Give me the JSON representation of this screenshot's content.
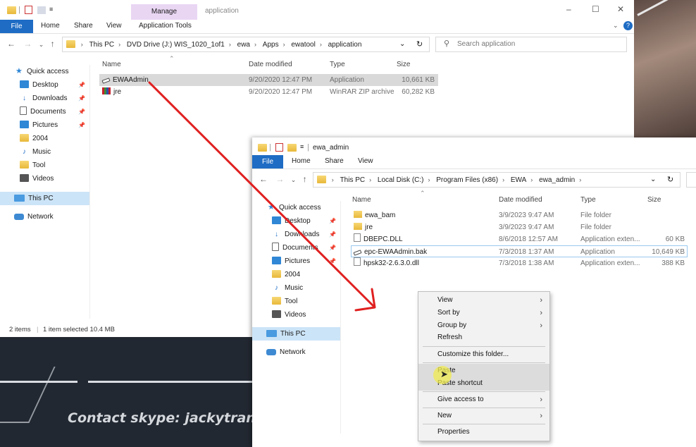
{
  "back_window": {
    "manage_tab": "Manage",
    "context_title": "application",
    "ribbon": [
      "File",
      "Home",
      "Share",
      "View",
      "Application Tools"
    ],
    "breadcrumb": [
      "This PC",
      "DVD Drive (J:) WIS_1020_1of1",
      "ewa",
      "Apps",
      "ewatool",
      "application"
    ],
    "search_placeholder": "Search application",
    "nav": [
      "Quick access",
      "Desktop",
      "Downloads",
      "Documents",
      "Pictures",
      "2004",
      "Music",
      "Tool",
      "Videos",
      "This PC",
      "Network"
    ],
    "columns": [
      "Name",
      "Date modified",
      "Type",
      "Size"
    ],
    "files": [
      {
        "name": "EWAAdmin",
        "date": "9/20/2020 12:47 PM",
        "type": "Application",
        "size": "10,661 KB"
      },
      {
        "name": "jre",
        "date": "9/20/2020 12:47 PM",
        "type": "WinRAR ZIP archive",
        "size": "60,282 KB"
      }
    ],
    "status_items": "2 items",
    "status_selected": "1 item selected  10.4 MB"
  },
  "front_window": {
    "title": "ewa_admin",
    "ribbon": [
      "File",
      "Home",
      "Share",
      "View"
    ],
    "breadcrumb": [
      "This PC",
      "Local Disk (C:)",
      "Program Files (x86)",
      "EWA",
      "ewa_admin"
    ],
    "nav": [
      "Quick access",
      "Desktop",
      "Downloads",
      "Documents",
      "Pictures",
      "2004",
      "Music",
      "Tool",
      "Videos",
      "This PC",
      "Network"
    ],
    "columns": [
      "Name",
      "Date modified",
      "Type",
      "Size"
    ],
    "files": [
      {
        "name": "ewa_bam",
        "date": "3/9/2023 9:47 AM",
        "type": "File folder",
        "size": ""
      },
      {
        "name": "jre",
        "date": "3/9/2023 9:47 AM",
        "type": "File folder",
        "size": ""
      },
      {
        "name": "DBEPC.DLL",
        "date": "8/6/2018 12:57 AM",
        "type": "Application exten...",
        "size": "60 KB"
      },
      {
        "name": "epc-EWAAdmin.bak",
        "date": "7/3/2018 1:37 AM",
        "type": "Application",
        "size": "10,649 KB"
      },
      {
        "name": "hpsk32-2.6.3.0.dll",
        "date": "7/3/2018 1:38 AM",
        "type": "Application exten...",
        "size": "388 KB"
      }
    ]
  },
  "context_menu": {
    "items": [
      "View",
      "Sort by",
      "Group by",
      "Refresh",
      "Customize this folder...",
      "Paste",
      "Paste shortcut",
      "Give access to",
      "New",
      "Properties"
    ]
  },
  "overlay": {
    "contact": "Contact skype: jackytrantv"
  },
  "colors": {
    "file_tab": "#1e6cc4",
    "manage_tab": "#e9d6f3",
    "arrow": "#e02020",
    "selection": "#cce4f7"
  }
}
